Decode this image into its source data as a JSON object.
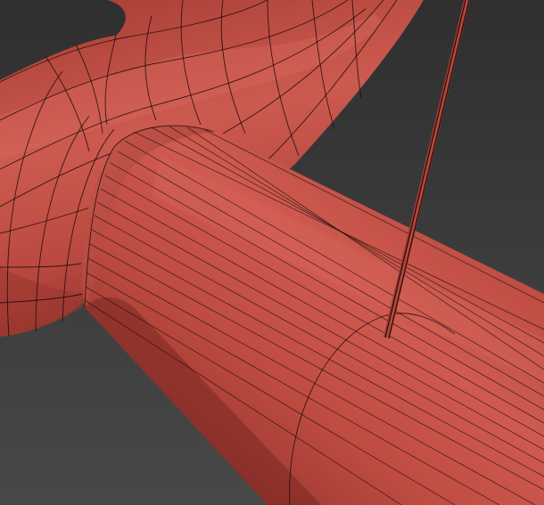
{
  "viewport": {
    "shading": "smooth-with-edged-faces",
    "colors": {
      "background_top": "#2f2f2f",
      "background_bottom": "#4a4a4a",
      "mesh_base": "#b8473c",
      "mesh_highlight": "#d9665a",
      "mesh_shadow": "#7a2a24",
      "wire": "#1a0c0a"
    },
    "objects": [
      "curved-tube-mesh",
      "cylinder-mesh",
      "thin-wire-rod"
    ]
  }
}
